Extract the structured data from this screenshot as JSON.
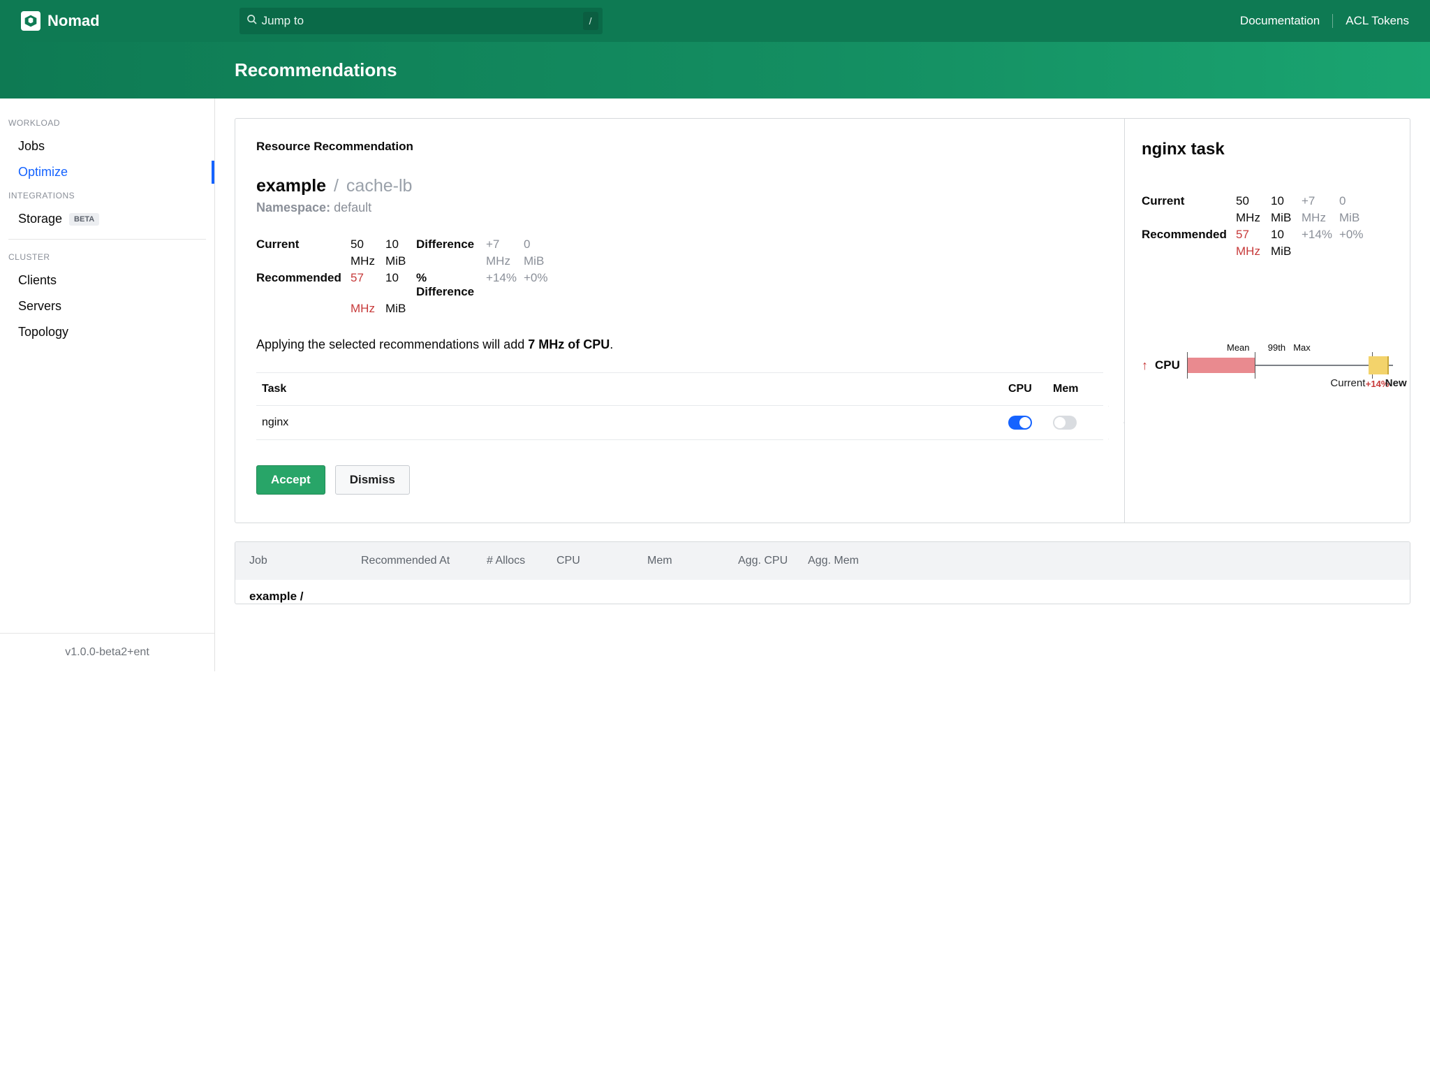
{
  "brand": "Nomad",
  "search": {
    "placeholder": "Jump to",
    "shortcut": "/"
  },
  "topnav_links": {
    "docs": "Documentation",
    "acl": "ACL Tokens"
  },
  "page_title": "Recommendations",
  "sidebar": {
    "groups": [
      {
        "title": "WORKLOAD",
        "items": [
          {
            "label": "Jobs",
            "active": false
          },
          {
            "label": "Optimize",
            "active": true
          }
        ]
      },
      {
        "title": "INTEGRATIONS",
        "items": [
          {
            "label": "Storage",
            "badge": "BETA"
          }
        ]
      },
      {
        "title": "CLUSTER",
        "items": [
          {
            "label": "Clients"
          },
          {
            "label": "Servers"
          },
          {
            "label": "Topology"
          }
        ]
      }
    ]
  },
  "version": "v1.0.0-beta2+ent",
  "rec": {
    "subhead": "Resource Recommendation",
    "job": "example",
    "group": "cache-lb",
    "ns_label": "Namespace:",
    "ns_value": "default",
    "labels": {
      "current": "Current",
      "recommended": "Recommended",
      "difference": "Difference",
      "pct_difference": "% Difference"
    },
    "current": {
      "cpu": "50",
      "cpu_unit": "MHz",
      "mem": "10",
      "mem_unit": "MiB"
    },
    "recommended": {
      "cpu": "57",
      "cpu_unit": "MHz",
      "mem": "10",
      "mem_unit": "MiB"
    },
    "diff": {
      "cpu": "+7",
      "cpu_unit": "MHz",
      "mem": "0",
      "mem_unit": "MiB"
    },
    "pct": {
      "cpu": "+14%",
      "mem": "+0%"
    },
    "impact_prefix": "Applying the selected recommendations will add ",
    "impact_value": "7 MHz of CPU",
    "impact_suffix": ".",
    "task_table": {
      "headers": {
        "task": "Task",
        "cpu": "CPU",
        "mem": "Mem"
      },
      "rows": [
        {
          "name": "nginx",
          "cpu_on": true,
          "mem_on": false
        }
      ]
    },
    "buttons": {
      "accept": "Accept",
      "dismiss": "Dismiss"
    }
  },
  "taskcard": {
    "title": "nginx task",
    "labels": {
      "current": "Current",
      "recommended": "Recommended"
    },
    "current": {
      "cpu": "50",
      "cpu_unit": "MHz",
      "mem": "10",
      "mem_unit": "MiB"
    },
    "recommended": {
      "cpu": "57",
      "cpu_unit": "MHz",
      "mem": "10",
      "mem_unit": "MiB"
    },
    "diff": {
      "cpu": "+7",
      "cpu_unit": "MHz",
      "mem": "0",
      "mem_unit": "MiB"
    },
    "pct": {
      "cpu": "+14%",
      "mem": "+0%"
    }
  },
  "chart_data": {
    "type": "bar",
    "axis_label": "CPU",
    "direction": "up",
    "markers_top": {
      "mean": "Mean",
      "p99": "99th",
      "max": "Max"
    },
    "markers_bottom": {
      "current": "Current",
      "delta": "+14%",
      "new": "New"
    },
    "current": 50,
    "recommended": 57,
    "mean_pct": 15,
    "p99_pct": 33,
    "max_pct": 37,
    "current_pos_pct": 90,
    "new_pos_pct": 100
  },
  "recs_table": {
    "headers": {
      "job": "Job",
      "rec_at": "Recommended At",
      "allocs": "# Allocs",
      "cpu": "CPU",
      "mem": "Mem",
      "agg_cpu": "Agg. CPU",
      "agg_mem": "Agg. Mem"
    },
    "row0": {
      "job": "example /"
    }
  }
}
